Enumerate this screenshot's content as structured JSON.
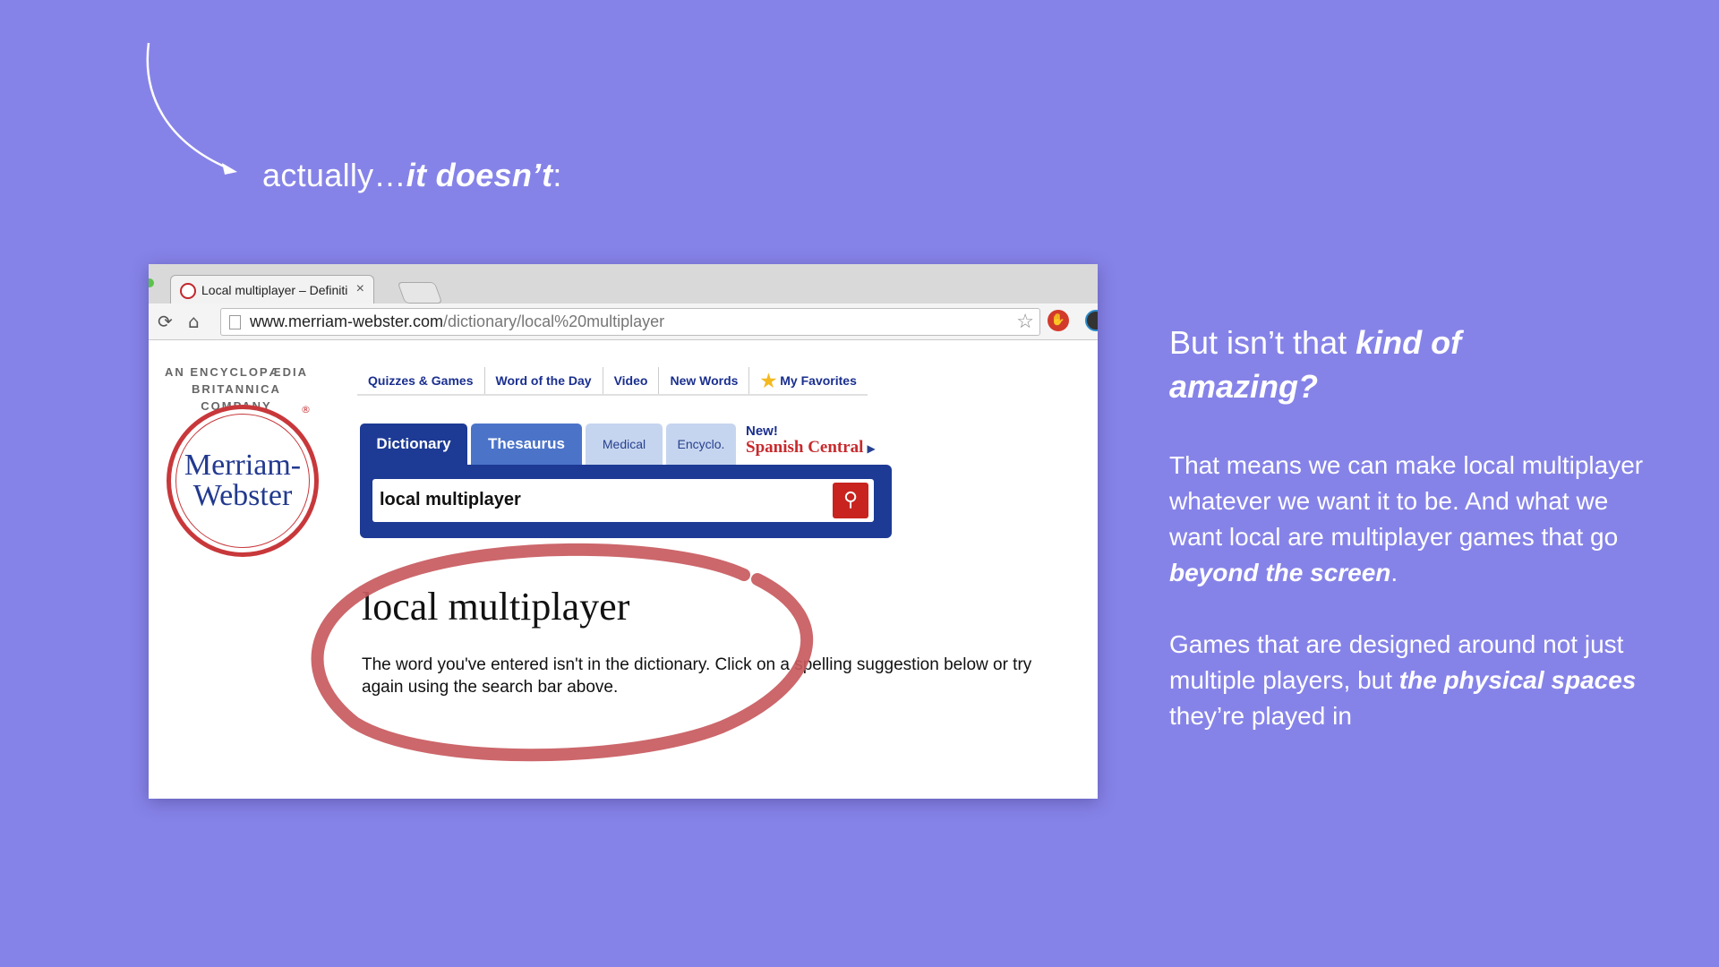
{
  "slide": {
    "intro_plain": "actually…",
    "intro_emphasis": "it doesn’t",
    "intro_tail": ":"
  },
  "browser": {
    "tab_title": "Local multiplayer – Definiti",
    "tab_close": "×",
    "url_host": "www.merriam-webster.com",
    "url_path": "/dictionary/local%20multiplayer"
  },
  "site": {
    "tagline_line1": "AN ENCYCLOPÆDIA",
    "tagline_line2": "BRITANNICA COMPANY",
    "logo_line1": "Merriam-",
    "logo_line2": "Webster",
    "logo_reg": "®",
    "nav": [
      "Quizzes & Games",
      "Word of the Day",
      "Video",
      "New Words",
      "My Favorites"
    ],
    "tabs": [
      "Dictionary",
      "Thesaurus",
      "Medical",
      "Encyclo."
    ],
    "promo_new": "New!",
    "promo_label": "Spanish Central",
    "search_value": "local multiplayer",
    "result_word": "local multiplayer",
    "result_message": "The word you've entered isn't in the dictionary. Click on a spelling suggestion below or try again using the search bar above."
  },
  "side": {
    "q_plain": "But isn’t that ",
    "q_emphasis": "kind of amazing?",
    "p1_plain": "That means we can make local multiplayer whatever we want it to be. And what we want local are multiplayer games that go ",
    "p1_emphasis": "beyond the screen",
    "p1_tail": ".",
    "p2_plain": "Games that are designed around not just multiple players, but ",
    "p2_emphasis": "the physical spaces",
    "p2_tail": " they’re played in"
  },
  "colors": {
    "background": "#8683e8",
    "mw_blue": "#1d3a94",
    "mw_red": "#c8383b",
    "highlight_ring": "#c85a5e"
  }
}
